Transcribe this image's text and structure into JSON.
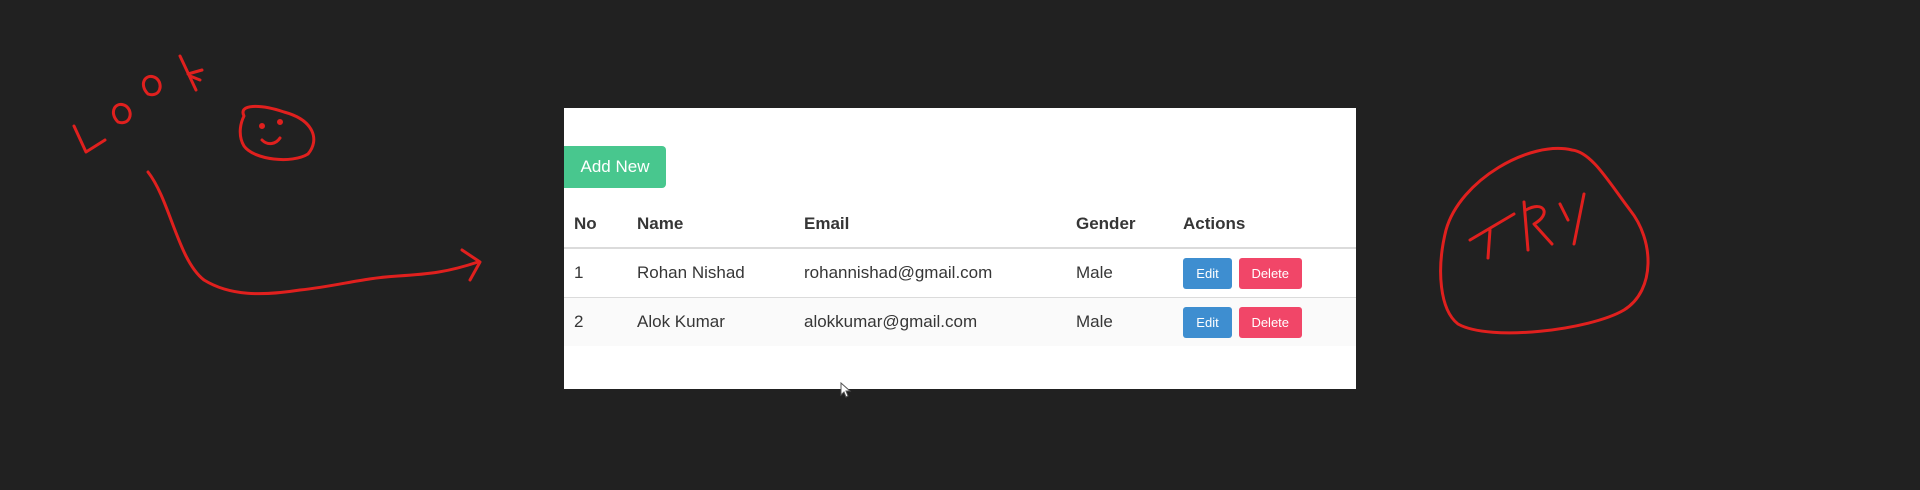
{
  "doodle": {
    "look_text": "LOOK",
    "try_text": "TRY",
    "ink_color": "#e0201e"
  },
  "toolbar": {
    "add_new_label": "Add New"
  },
  "table": {
    "headers": [
      "No",
      "Name",
      "Email",
      "Gender",
      "Actions"
    ],
    "rows": [
      {
        "no": "1",
        "name": "Rohan Nishad",
        "email": "rohannishad@gmail.com",
        "gender": "Male",
        "edit_label": "Edit",
        "delete_label": "Delete"
      },
      {
        "no": "2",
        "name": "Alok Kumar",
        "email": "alokkumar@gmail.com",
        "gender": "Male",
        "edit_label": "Edit",
        "delete_label": "Delete"
      }
    ]
  },
  "colors": {
    "background": "#212121",
    "add_button": "#48c78e",
    "edit_button": "#3e8ed0",
    "delete_button": "#f14668"
  }
}
